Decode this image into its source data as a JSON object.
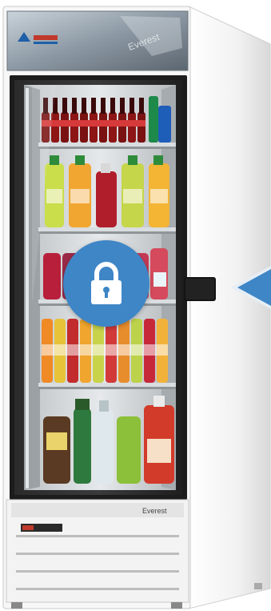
{
  "scene": {
    "subject": "glass-door-beverage-refrigerator",
    "accent_color": "#3f86c6",
    "lock_icon": "padlock-icon",
    "arrow_icon": "left-pointing-arrow"
  },
  "brand": {
    "header_logo": "Everest",
    "panel_logo": "Everest"
  }
}
